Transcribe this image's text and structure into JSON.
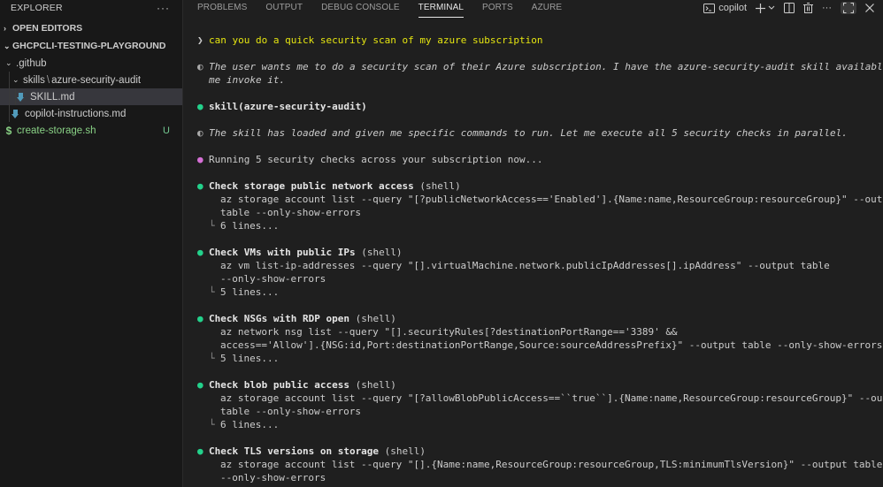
{
  "sidebar": {
    "title": "EXPLORER",
    "more_label": "···",
    "sections": {
      "open_editors": "OPEN EDITORS",
      "workspace": "GHCPCLI-TESTING-PLAYGROUND"
    },
    "tree": {
      "github": ".github",
      "skills": "skills",
      "sep": "\\",
      "audit": "azure-security-audit",
      "skill_md": "SKILL.md",
      "copilot_instructions": "copilot-instructions.md",
      "create_storage": "create-storage.sh",
      "create_storage_badge": "U"
    }
  },
  "panel": {
    "tabs": [
      "PROBLEMS",
      "OUTPUT",
      "DEBUG CONSOLE",
      "TERMINAL",
      "PORTS",
      "AZURE"
    ],
    "active_tab": "TERMINAL",
    "terminal_name": "copilot",
    "more_label": "···"
  },
  "terminal": {
    "prompt_symbol": "❯",
    "prompt": "can you do a quick security scan of my azure subscription",
    "thought1_l1": "The user wants me to do a security scan of their Azure subscription. I have the azure-security-audit skill available. Let",
    "thought1_l2": "me invoke it.",
    "skill_call": "skill(azure-security-audit)",
    "thought2": "The skill has loaded and given me specific commands to run. Let me execute all 5 security checks in parallel.",
    "running": "Running 5 security checks across your subscription now...",
    "bullet": "●",
    "thought_icon": "◐",
    "branch": "└",
    "shell_suffix": " (shell)",
    "checks": [
      {
        "title": "Check storage public network access",
        "lines": [
          "az storage account list --query \"[?publicNetworkAccess=='Enabled'].{Name:name,ResourceGroup:resourceGroup}\" --output",
          "table --only-show-errors"
        ],
        "result": "6 lines..."
      },
      {
        "title": "Check VMs with public IPs",
        "lines": [
          "az vm list-ip-addresses --query \"[].virtualMachine.network.publicIpAddresses[].ipAddress\" --output table",
          "--only-show-errors"
        ],
        "result": "5 lines..."
      },
      {
        "title": "Check NSGs with RDP open",
        "lines": [
          "az network nsg list --query \"[].securityRules[?destinationPortRange=='3389' &&",
          "access=='Allow'].{NSG:id,Port:destinationPortRange,Source:sourceAddressPrefix}\" --output table --only-show-errors"
        ],
        "result": "5 lines..."
      },
      {
        "title": "Check blob public access",
        "lines": [
          "az storage account list --query \"[?allowBlobPublicAccess==``true``].{Name:name,ResourceGroup:resourceGroup}\" --output",
          "table --only-show-errors"
        ],
        "result": "6 lines..."
      },
      {
        "title": "Check TLS versions on storage",
        "lines": [
          "az storage account list --query \"[].{Name:name,ResourceGroup:resourceGroup,TLS:minimumTlsVersion}\" --output table",
          "--only-show-errors"
        ],
        "result": ""
      }
    ]
  },
  "colors": {
    "background": "#1f1f1f",
    "sidebar": "#181818",
    "prompt_yellow": "#e5e510",
    "bullet_green": "#23d18b",
    "bullet_pink": "#d670d6",
    "untracked_green": "#73c991"
  }
}
